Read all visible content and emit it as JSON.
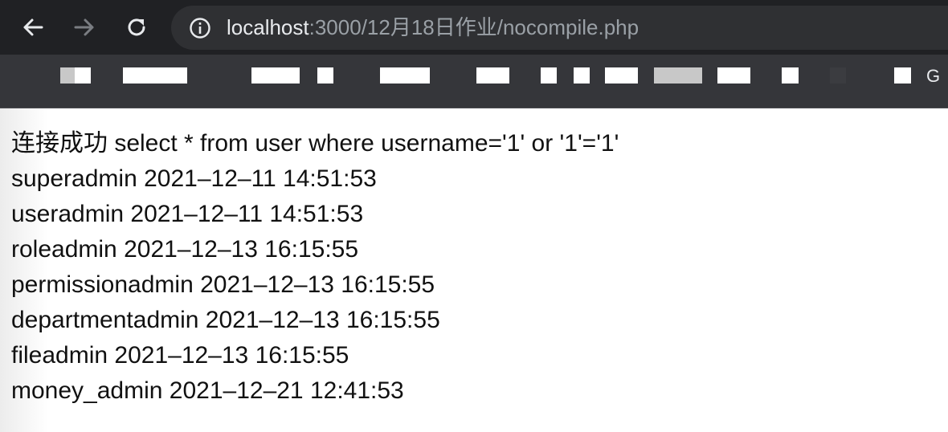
{
  "browser": {
    "url_host": "localhost",
    "url_path": ":3000/12月18日作业/nocompile.php",
    "back_icon": "arrow-left-icon",
    "forward_icon": "arrow-right-icon",
    "reload_icon": "reload-icon",
    "site_info_icon": "info-circle-icon",
    "bookmark_visible_text": "G",
    "colors": {
      "toolbar_bg": "#202124",
      "omnibox_bg": "#2f3033",
      "bookmarks_bg": "#35363a",
      "url_host": "#e8eaed",
      "url_path": "#9aa0a6"
    }
  },
  "page": {
    "header_line": "连接成功 select * from user where username='1' or '1'='1'",
    "rows": [
      "superadmin 2021–12–11 14:51:53",
      "useradmin 2021–12–11 14:51:53",
      "roleadmin 2021–12–13 16:15:55",
      "permissionadmin 2021–12–13 16:15:55",
      "departmentadmin 2021–12–13 16:15:55",
      "fileadmin 2021–12–13 16:15:55",
      "money_admin 2021–12–21 12:41:53"
    ]
  }
}
